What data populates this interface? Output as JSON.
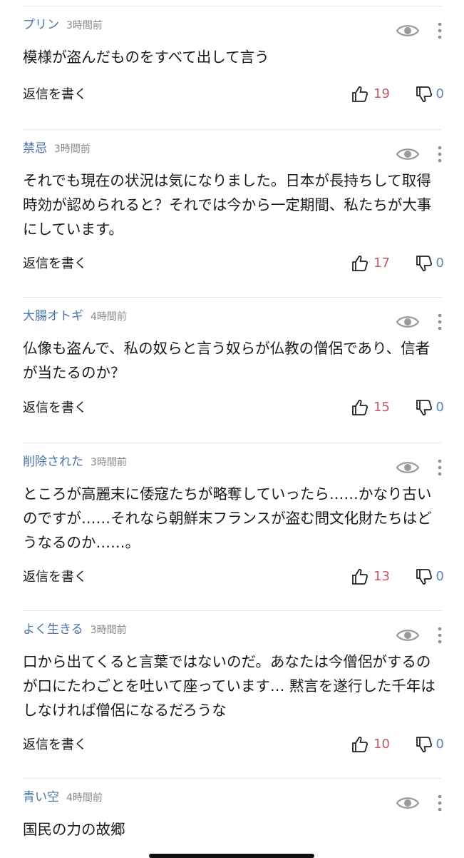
{
  "comments": [
    {
      "username": "プリン",
      "time": "3時間前",
      "body": "模様が盗んだものをすべて出して言う",
      "reply_label": "返信を書く",
      "likes": "19",
      "dislikes": "0"
    },
    {
      "username": "禁忌",
      "time": "3時間前",
      "body": "それでも現在の状況は気になりました。日本が長持ちして取得時効が認められると？それでは今から一定期間、私たちが大事にしています。",
      "reply_label": "返信を書く",
      "likes": "17",
      "dislikes": "0"
    },
    {
      "username": "大腸オトギ",
      "time": "4時間前",
      "body": "仏像も盗んで、私の奴らと言う奴らが仏教の僧侶であり、信者が当たるのか？",
      "reply_label": "返信を書く",
      "likes": "15",
      "dislikes": "0"
    },
    {
      "username": "削除された",
      "time": "3時間前",
      "body": "ところが高麗末に倭寇たちが略奪していったら……かなり古いのですが……それなら朝鮮末フランスが盗む問文化財たちはどうなるのか……。",
      "reply_label": "返信を書く",
      "likes": "13",
      "dislikes": "0"
    },
    {
      "username": "よく生きる",
      "time": "3時間前",
      "body": "口から出てくると言葉ではないのだ。あなたは今僧侶がするのが口にたわごとを吐いて座っています… 黙言を遂行した千年はしなければ僧侶になるだろうな",
      "reply_label": "返信を書く",
      "likes": "10",
      "dislikes": "0"
    },
    {
      "username": "青い空",
      "time": "4時間前",
      "body": "国民の力の故郷",
      "reply_label": "",
      "likes": "",
      "dislikes": ""
    }
  ],
  "colors": {
    "username": "#4a74a8",
    "like_count": "#c85563",
    "dislike_count": "#5f86bd"
  },
  "icons": {
    "view": "eye-icon",
    "more": "more-vertical-icon",
    "like": "thumbs-up-icon",
    "dislike": "thumbs-down-icon"
  }
}
